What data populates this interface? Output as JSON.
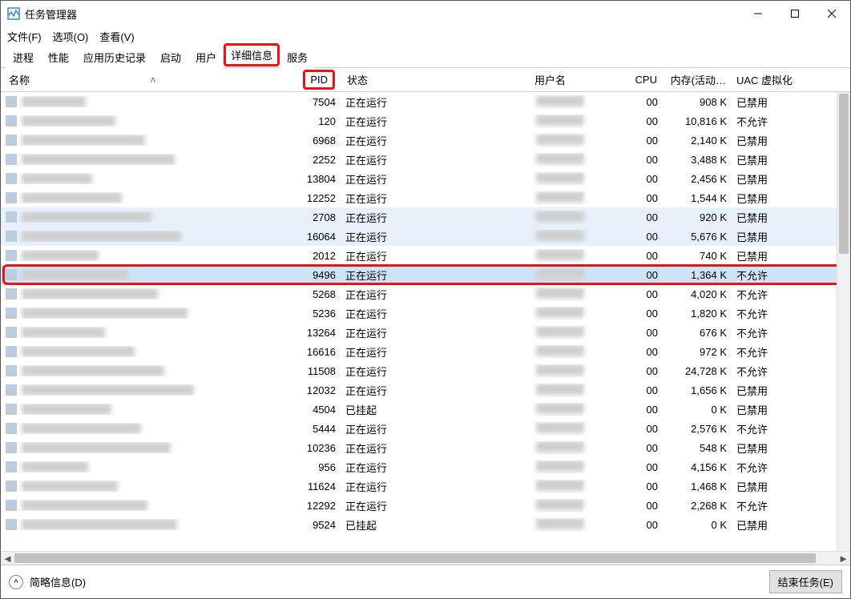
{
  "window": {
    "title": "任务管理器"
  },
  "menu": {
    "file": "文件(F)",
    "options": "选项(O)",
    "view": "查看(V)"
  },
  "tabs": {
    "processes": "进程",
    "performance": "性能",
    "app_history": "应用历史记录",
    "startup": "启动",
    "users": "用户",
    "details": "详细信息",
    "services": "服务"
  },
  "columns": {
    "name": "名称",
    "pid": "PID",
    "status": "状态",
    "user": "用户名",
    "cpu": "CPU",
    "mem": "内存(活动…",
    "uac": "UAC 虚拟化"
  },
  "status_running": "正在运行",
  "status_suspended": "已挂起",
  "uac_disabled": "已禁用",
  "uac_notallowed": "不允许",
  "rows": [
    {
      "pid": "7504",
      "status": "正在运行",
      "cpu": "00",
      "mem": "908 K",
      "uac": "已禁用"
    },
    {
      "pid": "120",
      "status": "正在运行",
      "cpu": "00",
      "mem": "10,816 K",
      "uac": "不允许"
    },
    {
      "pid": "6968",
      "status": "正在运行",
      "cpu": "00",
      "mem": "2,140 K",
      "uac": "已禁用"
    },
    {
      "pid": "2252",
      "status": "正在运行",
      "cpu": "00",
      "mem": "3,488 K",
      "uac": "已禁用"
    },
    {
      "pid": "13804",
      "status": "正在运行",
      "cpu": "00",
      "mem": "2,456 K",
      "uac": "已禁用"
    },
    {
      "pid": "12252",
      "status": "正在运行",
      "cpu": "00",
      "mem": "1,544 K",
      "uac": "已禁用"
    },
    {
      "pid": "2708",
      "status": "正在运行",
      "cpu": "00",
      "mem": "920 K",
      "uac": "已禁用",
      "sel": "light"
    },
    {
      "pid": "16064",
      "status": "正在运行",
      "cpu": "00",
      "mem": "5,676 K",
      "uac": "已禁用",
      "sel": "light"
    },
    {
      "pid": "2012",
      "status": "正在运行",
      "cpu": "00",
      "mem": "740 K",
      "uac": "已禁用"
    },
    {
      "pid": "9496",
      "status": "正在运行",
      "cpu": "00",
      "mem": "1,364 K",
      "uac": "不允许",
      "sel": "blue",
      "red": true
    },
    {
      "pid": "5268",
      "status": "正在运行",
      "cpu": "00",
      "mem": "4,020 K",
      "uac": "不允许"
    },
    {
      "pid": "5236",
      "status": "正在运行",
      "cpu": "00",
      "mem": "1,820 K",
      "uac": "不允许"
    },
    {
      "pid": "13264",
      "status": "正在运行",
      "cpu": "00",
      "mem": "676 K",
      "uac": "不允许"
    },
    {
      "pid": "16616",
      "status": "正在运行",
      "cpu": "00",
      "mem": "972 K",
      "uac": "不允许"
    },
    {
      "pid": "11508",
      "status": "正在运行",
      "cpu": "00",
      "mem": "24,728 K",
      "uac": "不允许"
    },
    {
      "pid": "12032",
      "status": "正在运行",
      "cpu": "00",
      "mem": "1,656 K",
      "uac": "已禁用"
    },
    {
      "pid": "4504",
      "status": "已挂起",
      "cpu": "00",
      "mem": "0 K",
      "uac": "已禁用"
    },
    {
      "pid": "5444",
      "status": "正在运行",
      "cpu": "00",
      "mem": "2,576 K",
      "uac": "不允许"
    },
    {
      "pid": "10236",
      "status": "正在运行",
      "cpu": "00",
      "mem": "548 K",
      "uac": "已禁用"
    },
    {
      "pid": "956",
      "status": "正在运行",
      "cpu": "00",
      "mem": "4,156 K",
      "uac": "不允许"
    },
    {
      "pid": "11624",
      "status": "正在运行",
      "cpu": "00",
      "mem": "1,468 K",
      "uac": "已禁用"
    },
    {
      "pid": "12292",
      "status": "正在运行",
      "cpu": "00",
      "mem": "2,268 K",
      "uac": "不允许"
    },
    {
      "pid": "9524",
      "status": "已挂起",
      "cpu": "00",
      "mem": "0 K",
      "uac": "已禁用"
    }
  ],
  "footer": {
    "brief": "简略信息(D)",
    "end_task": "结束任务(E)"
  }
}
